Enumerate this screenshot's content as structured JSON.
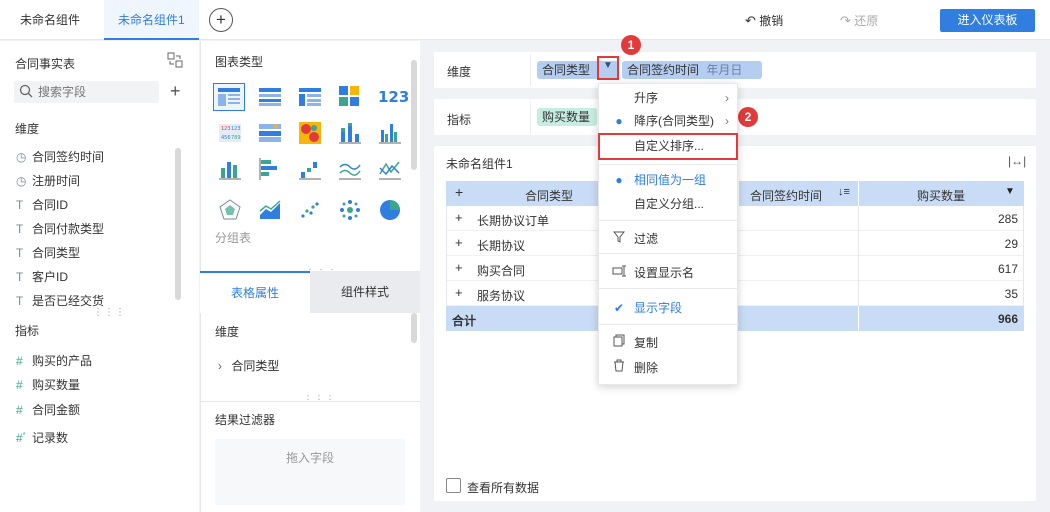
{
  "tabs": [
    {
      "label": "未命名组件",
      "active": false
    },
    {
      "label": "未命名组件1",
      "active": true
    }
  ],
  "top_actions": {
    "undo": "撤销",
    "redo": "还原",
    "enter_dashboard": "进入仪表板"
  },
  "left": {
    "dataset_title": "合同事实表",
    "search_placeholder": "搜索字段",
    "dimension_header": "维度",
    "dimensions": [
      {
        "label": "合同签约时间",
        "icon": "clock-icon"
      },
      {
        "label": "注册时间",
        "icon": "clock-icon"
      },
      {
        "label": "合同ID",
        "icon": "text-t-icon"
      },
      {
        "label": "合同付款类型",
        "icon": "text-t-icon"
      },
      {
        "label": "合同类型",
        "icon": "text-t-icon"
      },
      {
        "label": "客户ID",
        "icon": "text-t-icon"
      },
      {
        "label": "是否已经交货",
        "icon": "text-t-icon"
      }
    ],
    "metric_header": "指标",
    "metrics": [
      {
        "label": "购买的产品",
        "icon": "hash-icon"
      },
      {
        "label": "购买数量",
        "icon": "hash-icon"
      },
      {
        "label": "合同金额",
        "icon": "hash-icon"
      },
      {
        "label": "记录数",
        "icon": "hash-star-icon"
      }
    ]
  },
  "middle": {
    "chart_type_title": "图表类型",
    "group_table_label": "分组表",
    "tab_table_props": "表格属性",
    "tab_component_style": "组件样式",
    "dimension_header": "维度",
    "dimension_item": "合同类型",
    "result_filter_title": "结果过滤器",
    "drop_placeholder": "拖入字段"
  },
  "right": {
    "dimension_label": "维度",
    "dim_chip1": "合同类型",
    "dim_chip2": "合同签约时间",
    "dim_chip2_suffix": "年月日",
    "metric_label": "指标",
    "metric_chip": "购买数量",
    "component_title": "未命名组件1",
    "table": {
      "headers": [
        "合同类型",
        "合同签约时间",
        "购买数量"
      ],
      "rows": [
        {
          "type": "长期协议订单",
          "value": "285"
        },
        {
          "type": "长期协议",
          "value": "29"
        },
        {
          "type": "购买合同",
          "value": "617"
        },
        {
          "type": "服务协议",
          "value": "35"
        }
      ],
      "total_label": "合计",
      "total_value": "966"
    },
    "view_all_label": "查看所有数据"
  },
  "menu": {
    "items": {
      "asc": "升序",
      "desc": "降序(合同类型)",
      "custom_sort": "自定义排序...",
      "same_group": "相同值为一组",
      "custom_group": "自定义分组...",
      "filter": "过滤",
      "display_name": "设置显示名",
      "show_field": "显示字段",
      "copy": "复制",
      "delete": "删除"
    }
  },
  "callouts": {
    "one": "1",
    "two": "2"
  },
  "colors": {
    "accent": "#2f7ee0",
    "callout": "#e23a3a",
    "chip_dim": "#b5cdf0",
    "chip_metric": "#c7ece1"
  }
}
